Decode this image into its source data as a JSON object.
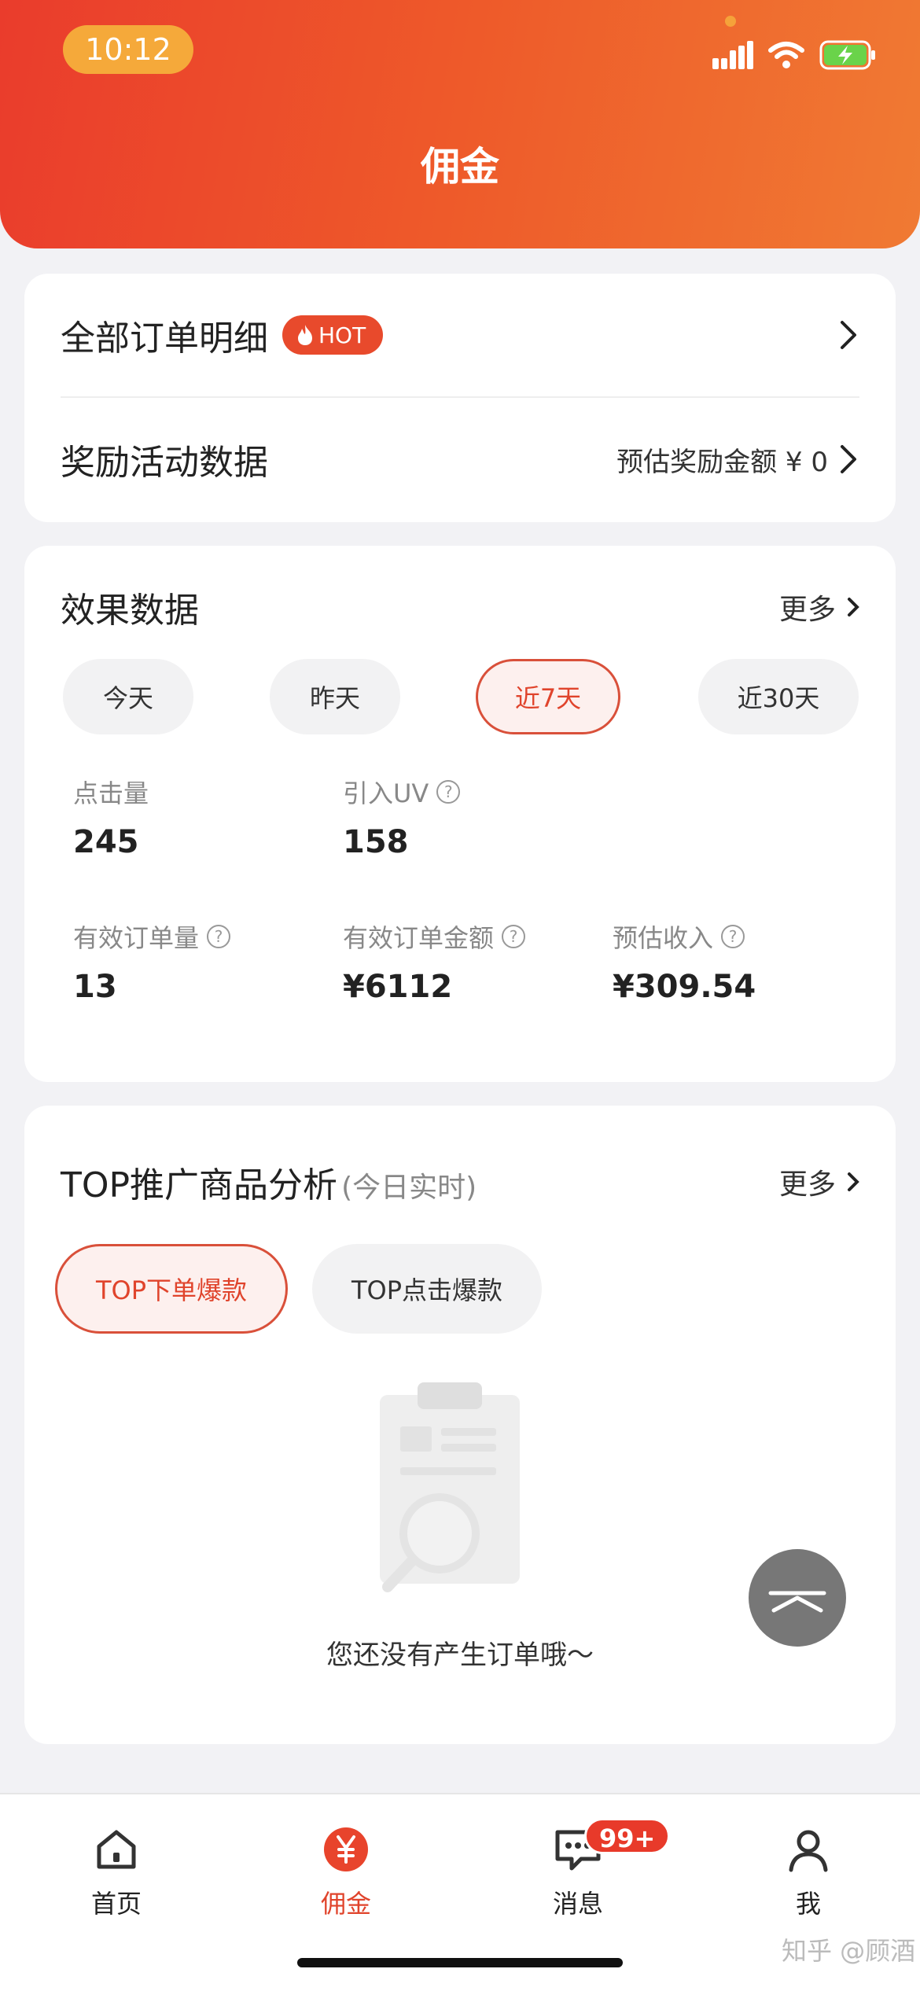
{
  "status_bar": {
    "time": "10:12"
  },
  "header": {
    "title": "佣金"
  },
  "orders_card": {
    "all_orders_label": "全部订单明细",
    "hot_badge": "HOT",
    "reward_label": "奖励活动数据",
    "reward_estimate": "预估奖励金额 ¥ 0"
  },
  "effect_card": {
    "title": "效果数据",
    "more": "更多",
    "ranges": [
      "今天",
      "昨天",
      "近7天",
      "近30天"
    ],
    "selected_range": "近7天",
    "metrics": [
      {
        "label": "点击量",
        "value": "245",
        "help": false
      },
      {
        "label": "引入UV",
        "value": "158",
        "help": true
      },
      {
        "label": "有效订单量",
        "value": "13",
        "help": true
      },
      {
        "label": "有效订单金额",
        "value": "¥6112",
        "help": true
      },
      {
        "label": "预估收入",
        "value": "¥309.54",
        "help": true
      }
    ]
  },
  "top_card": {
    "title": "TOP推广商品分析",
    "subtitle": "(今日实时)",
    "more": "更多",
    "tabs": [
      "TOP下单爆款",
      "TOP点击爆款"
    ],
    "selected_tab": "TOP下单爆款",
    "empty_text": "您还没有产生订单哦～"
  },
  "tabbar": {
    "items": [
      {
        "label": "首页",
        "icon": "home-icon"
      },
      {
        "label": "佣金",
        "icon": "yen-icon"
      },
      {
        "label": "消息",
        "icon": "message-icon",
        "badge": "99+"
      },
      {
        "label": "我",
        "icon": "person-icon"
      }
    ],
    "active": "佣金"
  },
  "watermark": "知乎 @顾酒",
  "colors": {
    "accent": "#e0442c",
    "header_start": "#ea3c2c",
    "header_end": "#f07a33"
  }
}
